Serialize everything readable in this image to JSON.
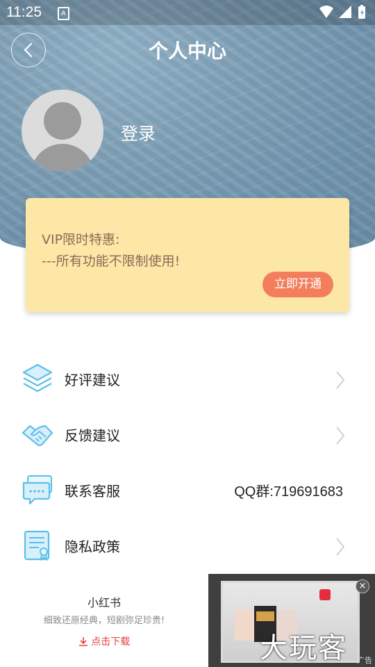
{
  "status_bar": {
    "time": "11:25",
    "a_label": "A"
  },
  "header": {
    "title": "个人中心",
    "login_text": "登录"
  },
  "vip": {
    "line1": "VIP限时特惠:",
    "line2": "---所有功能不限制使用!",
    "button": "立即开通"
  },
  "menu": [
    {
      "label": "好评建议",
      "icon": "layers-icon",
      "value": ""
    },
    {
      "label": "反馈建议",
      "icon": "handshake-icon",
      "value": ""
    },
    {
      "label": "联系客服",
      "icon": "chat-bubble-icon",
      "value": "QQ群:719691683"
    },
    {
      "label": "隐私政策",
      "icon": "document-icon",
      "value": ""
    }
  ],
  "ad": {
    "app_name": "小红书",
    "description": "细致还原经典，短剧弥足珍贵!",
    "download": "点击下载",
    "watermark": "大玩客",
    "ad_tag": "广告"
  },
  "colors": {
    "accent": "#f37e5e",
    "vip_bg": "#fde7a7",
    "icon_blue": "#5bbfe9"
  }
}
